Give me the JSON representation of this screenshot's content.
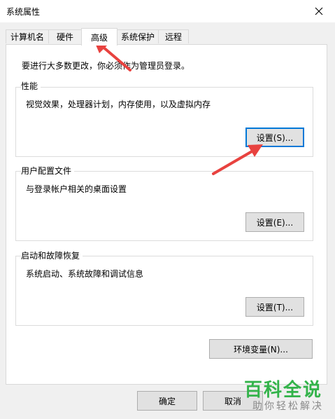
{
  "window": {
    "title": "系统属性",
    "close_icon": "close-icon"
  },
  "tabs": [
    {
      "label": "计算机名",
      "active": false
    },
    {
      "label": "硬件",
      "active": false
    },
    {
      "label": "高级",
      "active": true
    },
    {
      "label": "系统保护",
      "active": false
    },
    {
      "label": "远程",
      "active": false
    }
  ],
  "advanced": {
    "admin_note": "要进行大多数更改，你必须作为管理员登录。",
    "performance": {
      "title": "性能",
      "description": "视觉效果，处理器计划，内存使用，以及虚拟内存",
      "settings_button": "设置(S)..."
    },
    "user_profiles": {
      "title": "用户配置文件",
      "description": "与登录帐户相关的桌面设置",
      "settings_button": "设置(E)..."
    },
    "startup_recovery": {
      "title": "启动和故障恢复",
      "description": "系统启动、系统故障和调试信息",
      "settings_button": "设置(T)..."
    },
    "env_button": "环境变量(N)..."
  },
  "footer": {
    "ok_button": "确定",
    "cancel_button": "取消"
  },
  "watermark": {
    "main": "百科全说",
    "sub": "助你轻松解决"
  },
  "annotation_color": "#e8423f"
}
